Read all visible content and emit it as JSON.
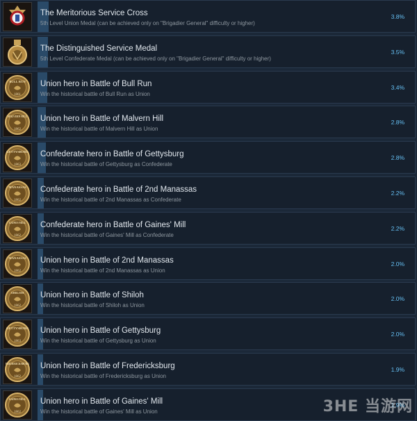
{
  "achievements": [
    {
      "title": "The Meritorious Service Cross",
      "description": "5th Level Union Medal (can be achieved only on \"Brigadier General\" difficulty or higher)",
      "percent": "3.8%",
      "progress": 0.038,
      "icon": "service-cross-icon"
    },
    {
      "title": "The Distinguished Service Medal",
      "description": "5th Level Confederate Medal (can be achieved only on \"Brigadier General\" difficulty or higher)",
      "percent": "3.5%",
      "progress": 0.035,
      "icon": "service-medal-icon"
    },
    {
      "title": "Union hero in Battle of Bull Run",
      "description": "Win the historical battle of Bull Run as Union",
      "percent": "3.4%",
      "progress": 0.034,
      "icon": "bull-run-coin-icon",
      "coin_label": "BULL RUN",
      "coin_year": "1861"
    },
    {
      "title": "Union hero in Battle of Malvern Hill",
      "description": "Win the historical battle of Malvern Hill as Union",
      "percent": "2.8%",
      "progress": 0.028,
      "icon": "malvern-hill-coin-icon",
      "coin_label": "MALVERN HILL",
      "coin_year": "1862"
    },
    {
      "title": "Confederate hero in Battle of Gettysburg",
      "description": "Win the historical battle of Gettysburg as Confederate",
      "percent": "2.8%",
      "progress": 0.028,
      "icon": "gettysburg-coin-icon",
      "coin_label": "GETTYSBURG",
      "coin_year": "1863"
    },
    {
      "title": "Confederate hero in Battle of 2nd Manassas",
      "description": "Win the historical battle of 2nd Manassas as Confederate",
      "percent": "2.2%",
      "progress": 0.022,
      "icon": "manassas-coin-icon",
      "coin_label": "MANASSAS",
      "coin_year": "1862"
    },
    {
      "title": "Confederate hero in Battle of Gaines' Mill",
      "description": "Win the historical battle of Gaines' Mill as Confederate",
      "percent": "2.2%",
      "progress": 0.022,
      "icon": "gaines-mill-coin-icon",
      "coin_label": "GAINES MILL",
      "coin_year": "1862"
    },
    {
      "title": "Union hero in Battle of 2nd Manassas",
      "description": "Win the historical battle of 2nd Manassas as Union",
      "percent": "2.0%",
      "progress": 0.02,
      "icon": "manassas-coin-icon",
      "coin_label": "MANASSAS",
      "coin_year": "1862"
    },
    {
      "title": "Union hero in Battle of Shiloh",
      "description": "Win the historical battle of Shiloh as Union",
      "percent": "2.0%",
      "progress": 0.02,
      "icon": "shiloh-coin-icon",
      "coin_label": "SHILOH",
      "coin_year": "1862"
    },
    {
      "title": "Union hero in Battle of Gettysburg",
      "description": "Win the historical battle of Gettysburg as Union",
      "percent": "2.0%",
      "progress": 0.02,
      "icon": "gettysburg-coin-icon",
      "coin_label": "GETTYSBURG",
      "coin_year": "1863"
    },
    {
      "title": "Union hero in Battle of Fredericksburg",
      "description": "Win the historical battle of Fredericksburg as Union",
      "percent": "1.9%",
      "progress": 0.019,
      "icon": "fredericksburg-coin-icon",
      "coin_label": "FREDERICKSBURG",
      "coin_year": "1862"
    },
    {
      "title": "Union hero in Battle of Gaines' Mill",
      "description": "Win the historical battle of Gaines' Mill as Union",
      "percent": "1.9%",
      "progress": 0.019,
      "icon": "gaines-mill-coin-icon",
      "coin_label": "GAINES MILL",
      "coin_year": "1862"
    }
  ],
  "watermark": "3HE 当游网"
}
